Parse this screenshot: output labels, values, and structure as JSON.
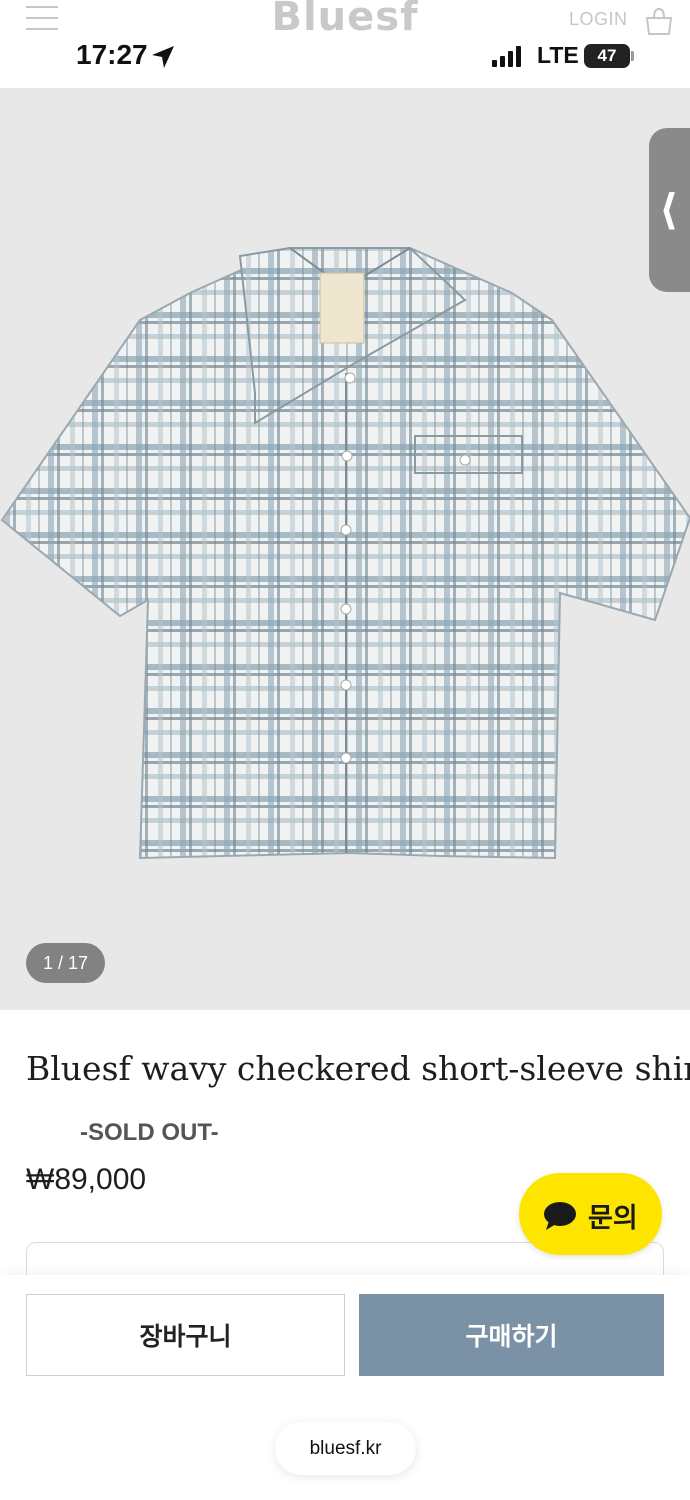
{
  "status_bar": {
    "time": "17:27",
    "network": "LTE",
    "battery": "47"
  },
  "header": {
    "logo": "Bluesf",
    "login_label": "LOGIN",
    "menu_icon": "hamburger-icon",
    "bag_icon": "shopping-bag-icon"
  },
  "gallery": {
    "counter": "1 / 17",
    "current": 1,
    "total": 17,
    "side_tab_icon": "chevron-left-icon"
  },
  "product": {
    "title": "Bluesf wavy checkered short-sleeve shirt",
    "status": "-SOLD OUT-",
    "price": "₩89,000"
  },
  "inquiry_button": {
    "label": "문의",
    "icon": "chat-bubble-icon",
    "color": "#fee500"
  },
  "actions": {
    "cart_label": "장바구니",
    "buy_label": "구매하기",
    "buy_color": "#7a91a6"
  },
  "browser": {
    "url": "bluesf.kr"
  }
}
